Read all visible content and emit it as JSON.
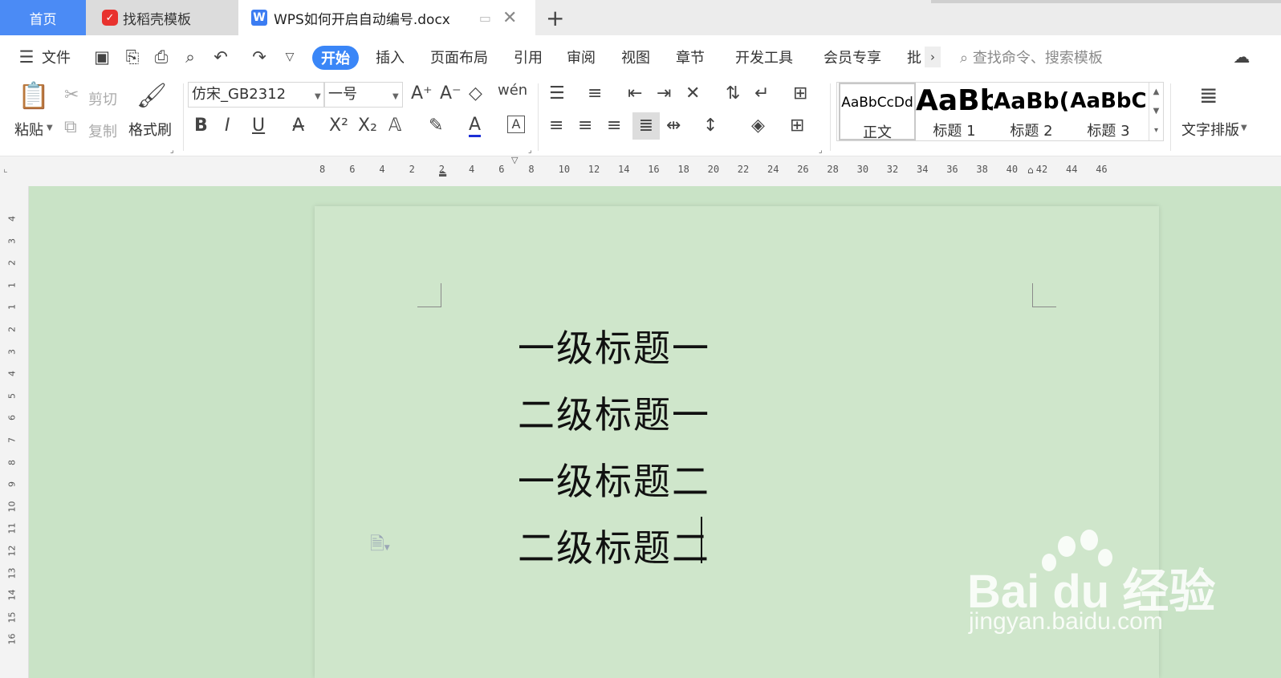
{
  "tabs": {
    "home": "首页",
    "daoke": "找稻壳模板",
    "doc": "WPS如何开启自动编号.docx",
    "add": "+"
  },
  "menubar": {
    "file": "文件",
    "items": [
      "开始",
      "插入",
      "页面布局",
      "引用",
      "审阅",
      "视图",
      "章节",
      "开发工具",
      "会员专享",
      "批"
    ],
    "search_placeholder": "查找命令、搜索模板"
  },
  "ribbon": {
    "paste": "粘贴",
    "cut": "剪切",
    "copy": "复制",
    "format_painter": "格式刷",
    "font_name": "仿宋_GB2312",
    "font_size": "一号",
    "styles": [
      {
        "sample": "AaBbCcDd",
        "name": "正文"
      },
      {
        "sample": "AaBb",
        "name": "标题 1"
      },
      {
        "sample": "AaBb(",
        "name": "标题 2"
      },
      {
        "sample": "AaBbC",
        "name": "标题 3"
      }
    ],
    "text_layout": "文字排版"
  },
  "ruler": {
    "ticks": [
      "8",
      "6",
      "4",
      "2",
      "2",
      "4",
      "6",
      "8",
      "10",
      "12",
      "14",
      "16",
      "18",
      "20",
      "22",
      "24",
      "26",
      "28",
      "30",
      "32",
      "34",
      "36",
      "38",
      "40",
      "42",
      "44",
      "46"
    ]
  },
  "vruler": {
    "ticks": [
      "4",
      "3",
      "2",
      "1",
      "1",
      "2",
      "3",
      "4",
      "5",
      "6",
      "7",
      "8",
      "9",
      "10",
      "11",
      "12",
      "13",
      "14",
      "15",
      "16"
    ]
  },
  "document": {
    "lines": [
      "一级标题一",
      "二级标题一",
      "一级标题二",
      "二级标题二"
    ]
  },
  "watermark": {
    "brand": "Bai du 经验",
    "url": "jingyan.baidu.com"
  },
  "colors": {
    "tab_home_bg": "#4b8bf5",
    "start_button": "#3a86f7",
    "page_bg": "#cfe6cb"
  }
}
